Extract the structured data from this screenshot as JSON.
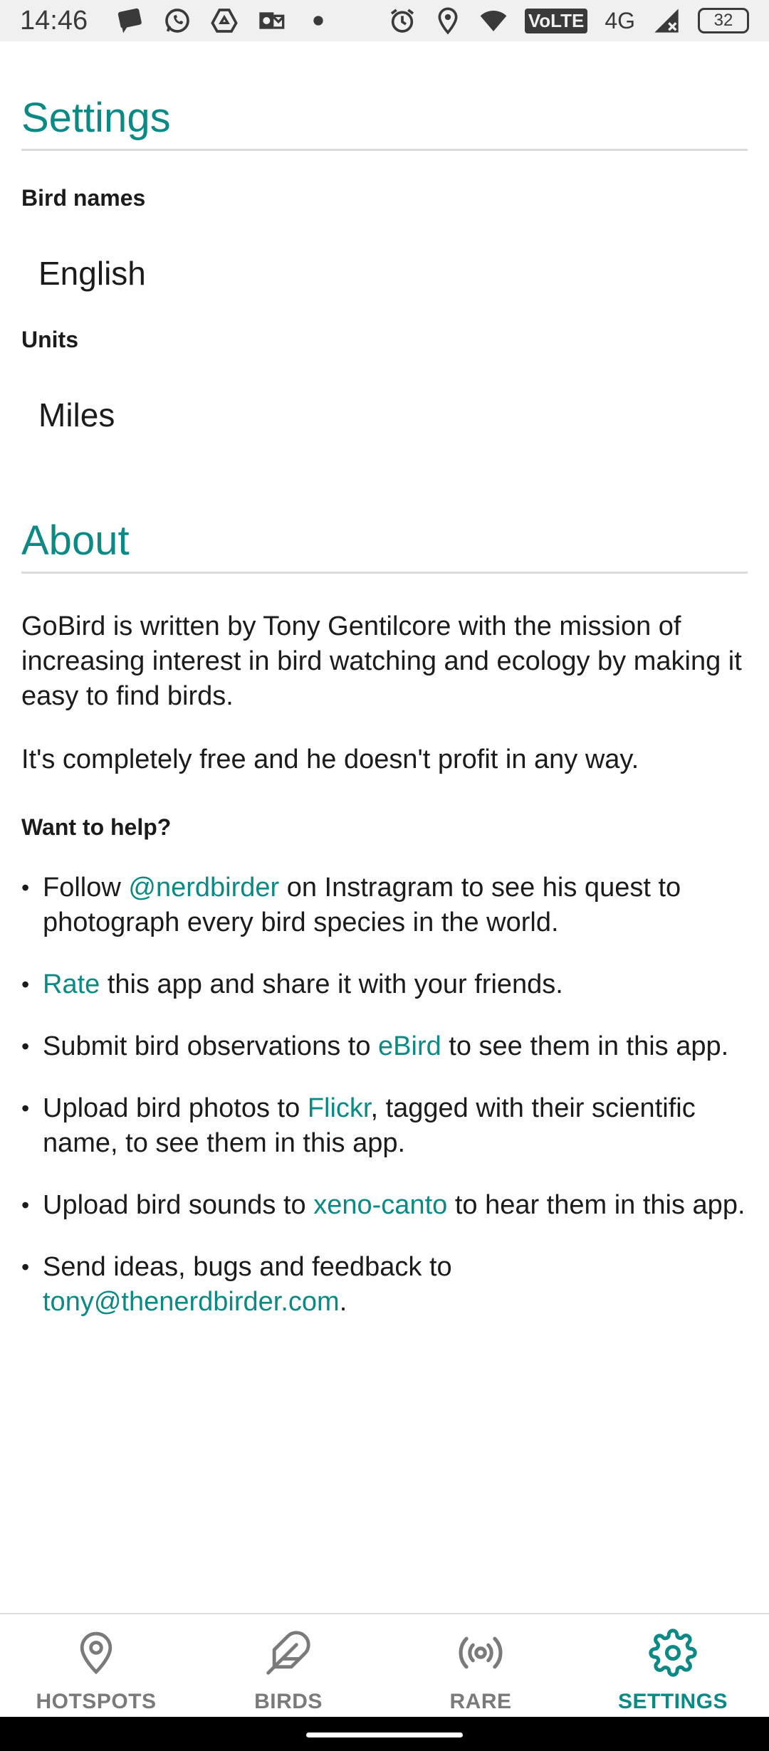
{
  "status_bar": {
    "time": "14:46",
    "volte": "VoLTE",
    "network": "4G",
    "battery": "32"
  },
  "settings": {
    "title": "Settings",
    "bird_names_label": "Bird names",
    "bird_names_value": "English",
    "units_label": "Units",
    "units_value": "Miles"
  },
  "about": {
    "title": "About",
    "para1": "GoBird is written by Tony Gentilcore with the mission of increasing interest in bird watching and ecology by making it easy to find birds.",
    "para2": "It's completely free and he doesn't profit in any way.",
    "help_label": "Want to help?",
    "items": [
      {
        "pre": "Follow ",
        "link": "@nerdbirder",
        "post": " on Instragram to see his quest to photograph every bird species in the world."
      },
      {
        "pre": "",
        "link": "Rate",
        "post": " this app and share it with your friends."
      },
      {
        "pre": "Submit bird observations to ",
        "link": "eBird",
        "post": " to see them in this app."
      },
      {
        "pre": "Upload bird photos to ",
        "link": "Flickr",
        "post": ", tagged with their scientific name, to see them in this app."
      },
      {
        "pre": "Upload bird sounds to ",
        "link": "xeno-canto",
        "post": " to hear them in this app."
      },
      {
        "pre": "Send ideas, bugs and feedback to ",
        "link": "tony@thenerdbirder.com",
        "post": "."
      }
    ]
  },
  "nav": {
    "items": [
      {
        "label": "HOTSPOTS",
        "icon": "location-pin-icon"
      },
      {
        "label": "BIRDS",
        "icon": "feather-icon"
      },
      {
        "label": "RARE",
        "icon": "broadcast-icon"
      },
      {
        "label": "SETTINGS",
        "icon": "gear-icon"
      }
    ],
    "active": "SETTINGS"
  },
  "colors": {
    "accent": "#0b8a85",
    "inactive": "#7a7a7a"
  }
}
